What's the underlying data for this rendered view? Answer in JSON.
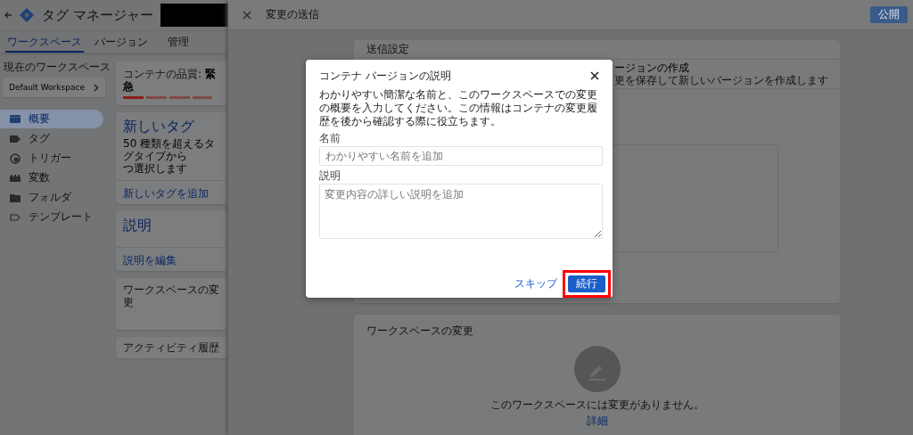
{
  "app": {
    "title": "タグ マネージャー",
    "tabs": [
      {
        "label": "ワークスペース",
        "selected": true
      },
      {
        "label": "バージョン",
        "selected": false
      },
      {
        "label": "管理",
        "selected": false
      }
    ],
    "workspace": {
      "label": "現在のワークスペース",
      "name": "Default Workspace"
    },
    "nav": [
      {
        "kind": "overview",
        "label": "概要",
        "selected": true
      },
      {
        "kind": "tag",
        "label": "タグ",
        "selected": false
      },
      {
        "kind": "trigger",
        "label": "トリガー",
        "selected": false
      },
      {
        "kind": "variable",
        "label": "変数",
        "selected": false
      },
      {
        "kind": "folder",
        "label": "フォルダ",
        "selected": false
      },
      {
        "kind": "template",
        "label": "テンプレート",
        "selected": false
      }
    ],
    "quality": {
      "text": "コンテナの品質: **緊急**"
    },
    "new_tag": {
      "title": "新しいタグ",
      "lines": [
        "50 種類を超えるタグタイプから",
        "つ選択します"
      ],
      "link": "新しいタグを追加"
    },
    "description_card": {
      "title": "説明",
      "link": "説明を編集"
    },
    "workspace_changes": {
      "title": "ワークスペースの変更"
    },
    "activity": {
      "title": "アクティビティ履歴"
    }
  },
  "submit_panel": {
    "title": "変更の送信",
    "publish": "公開",
    "settings": {
      "title": "送信設定",
      "option_title": "ージョンの作成",
      "option_text": "更を保存して新しいバージョンを作成します"
    },
    "changes": {
      "title": "ワークスペースの変更",
      "empty_text": "このワークスペースには変更がありません。",
      "link": "詳細"
    }
  },
  "dialog": {
    "title": "コンテナ バージョンの説明",
    "intro": "わかりやすい簡潔な名前と、このワークスペースでの変更の概要を入力してください。この情報はコンテナの変更履歴を後から確認する際に役立ちます。",
    "fields": [
      {
        "kind": "input",
        "label": "名前",
        "placeholder": "わかりやすい名前を追加"
      },
      {
        "kind": "textarea",
        "label": "説明",
        "placeholder": "変更内容の詳しい説明を追加"
      }
    ],
    "skip": "スキップ",
    "continue": {
      "label": "続行",
      "highlighted": true
    }
  }
}
